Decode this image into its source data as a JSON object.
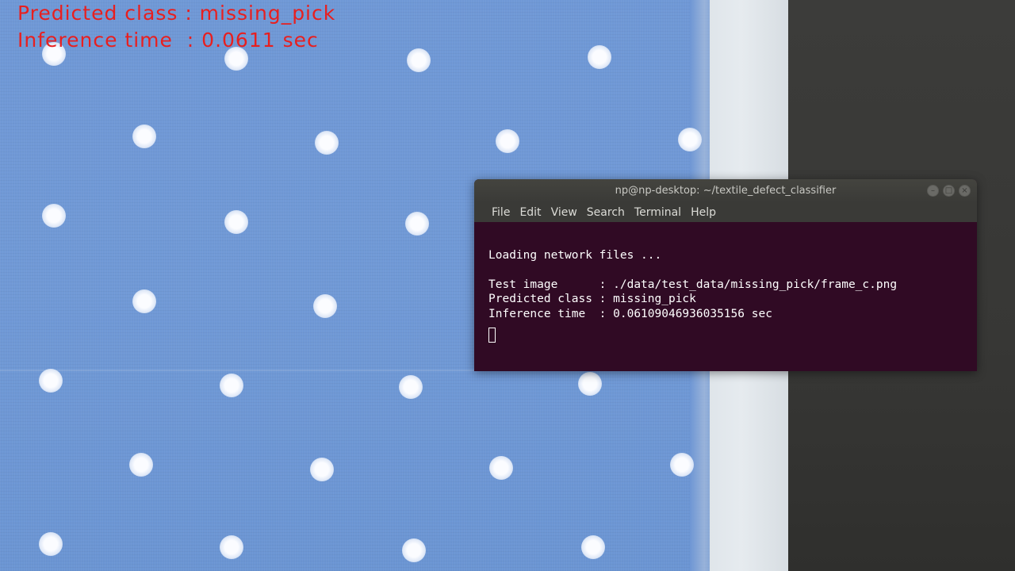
{
  "overlay": {
    "predicted_line": "Predicted class : missing_pick",
    "inference_line": "Inference time  : 0.0611 sec",
    "color": "#e81f1f"
  },
  "terminal": {
    "title": "np@np-desktop: ~/textile_defect_classifier",
    "window_buttons": [
      "minimize-icon",
      "maximize-icon",
      "close-icon"
    ],
    "menu": [
      "File",
      "Edit",
      "View",
      "Search",
      "Terminal",
      "Help"
    ],
    "lines": [
      "",
      "Loading network files ...",
      "",
      "Test image      : ./data/test_data/missing_pick/frame_c.png",
      "Predicted class : missing_pick",
      "Inference time  : 0.06109046936035156 sec"
    ],
    "background": "#300a24"
  },
  "scene": {
    "fabric_color": "#7099d6",
    "dot_color": "#ffffff"
  }
}
